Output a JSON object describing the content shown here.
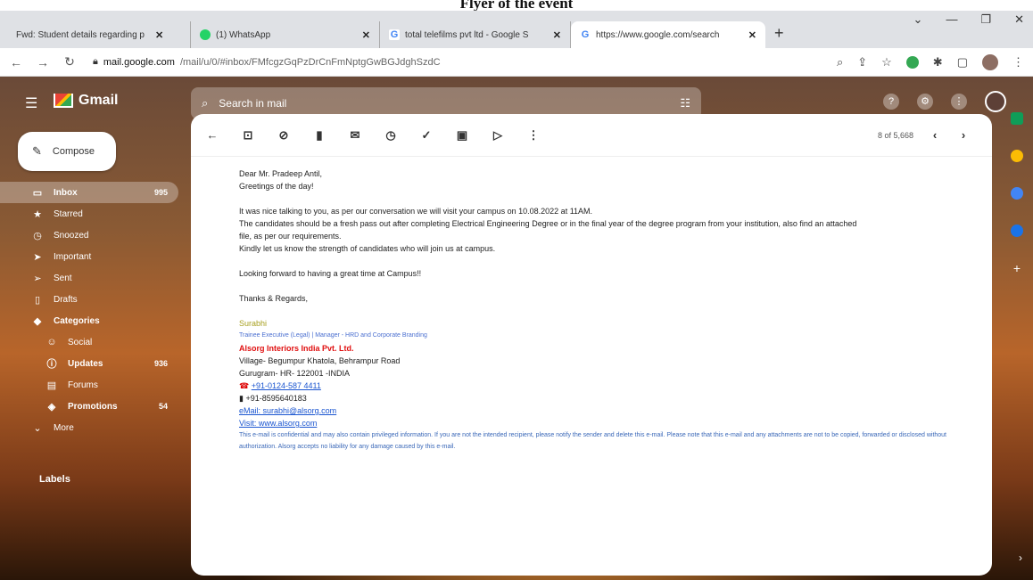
{
  "doc_title": "Flyer of the event",
  "tabs": [
    {
      "label": "Fwd: Student details regarding p",
      "favicon": "gmail"
    },
    {
      "label": "(1) WhatsApp",
      "favicon": "whatsapp"
    },
    {
      "label": "total telefilms pvt ltd - Google S",
      "favicon": "google"
    },
    {
      "label": "https://www.google.com/search",
      "favicon": "google"
    }
  ],
  "address": {
    "host": "mail.google.com",
    "path": "/mail/u/0/#inbox/FMfcgzGqPzDrCnFmNptgGwBGJdghSzdC"
  },
  "gmail": {
    "brand": "Gmail",
    "search_placeholder": "Search in mail",
    "compose": "Compose",
    "labels_heading": "Labels",
    "nav": [
      {
        "label": "Inbox",
        "count": "995",
        "icon": "inbox-icon",
        "active": true
      },
      {
        "label": "Starred",
        "count": "",
        "icon": "star-icon"
      },
      {
        "label": "Snoozed",
        "count": "",
        "icon": "clock-icon"
      },
      {
        "label": "Important",
        "count": "",
        "icon": "important-icon"
      },
      {
        "label": "Sent",
        "count": "",
        "icon": "send-icon"
      },
      {
        "label": "Drafts",
        "count": "",
        "icon": "draft-icon"
      },
      {
        "label": "Categories",
        "count": "",
        "icon": "label-icon"
      },
      {
        "label": "Social",
        "count": "",
        "icon": "people-icon"
      },
      {
        "label": "Updates",
        "count": "936",
        "icon": "info-icon"
      },
      {
        "label": "Forums",
        "count": "",
        "icon": "forum-icon"
      },
      {
        "label": "Promotions",
        "count": "54",
        "icon": "tag-icon"
      },
      {
        "label": "More",
        "count": "",
        "icon": "chevron-down-icon"
      }
    ],
    "pager": "8 of 5,668"
  },
  "mail": {
    "greeting": "Dear Mr. Pradeep Antil,",
    "greeting2": "Greetings of the day!",
    "para1": "It was nice talking to you, as per our conversation we will visit your campus on 10.08.2022 at 11AM.",
    "para2": "The candidates should be a fresh pass out after completing Electrical Engineering Degree or in the final year of the degree program from your institution, also find an attached",
    "para3": "file, as per our requirements.",
    "para4": "Kindly let us know the strength of candidates who will join us at campus.",
    "para5": "Looking forward to having a great time at Campus!!",
    "closing": "Thanks & Regards,",
    "sig_name": "Surabhi",
    "sig_title": "Trainee Executive (Legal) | Manager - HRD and Corporate Branding",
    "sig_company": "Alsorg Interiors India Pvt. Ltd.",
    "sig_addr1": "Village- Begumpur Khatola, Behrampur Road",
    "sig_addr2": "Gurugram- HR- 122001 -INDIA",
    "sig_phone1": "+91-0124-587 4411",
    "sig_phone2": "+91-8595640183",
    "sig_email": "eMail: surabhi@alsorg.com",
    "sig_web": "Visit: www.alsorg.com",
    "disclaimer": "This e-mail is confidential and may also contain privileged information. If you are not the intended recipient, please notify the sender and delete this e-mail. Please note that this e-mail and any attachments are not to be copied, forwarded or disclosed without authorization. Alsorg accepts no liability for any damage caused by this e-mail."
  }
}
